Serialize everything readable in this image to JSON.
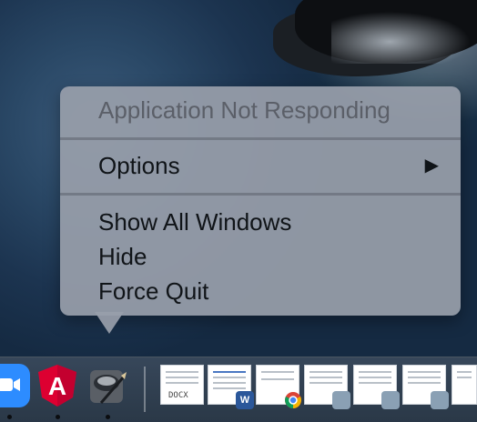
{
  "menu": {
    "header_label": "Application Not Responding",
    "options_label": "Options",
    "options_arrow": "▶",
    "items": [
      {
        "label": "Show All Windows"
      },
      {
        "label": "Hide"
      },
      {
        "label": "Force Quit"
      }
    ]
  },
  "dock": {
    "angular_letter": "A",
    "docx_label": "DOCX",
    "word_badge": "W",
    "colors": {
      "zoom": "#2d8cff",
      "angular": "#dd0031",
      "word": "#2b579a"
    }
  }
}
